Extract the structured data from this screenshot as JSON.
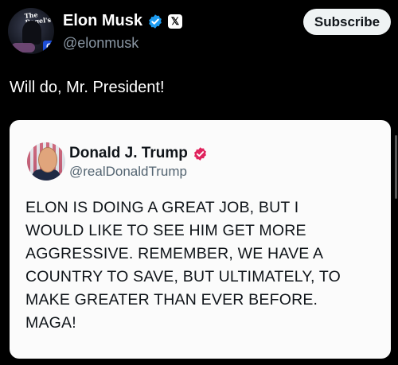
{
  "post": {
    "author": {
      "display_name": "Elon Musk",
      "handle": "@elonmusk",
      "avatar_text": "The Bagel's",
      "avatar_badge": "C",
      "verified_icon": "verified-badge-icon",
      "x_badge_text": "𝕏"
    },
    "subscribe_label": "Subscribe",
    "text": "Will do, Mr. President!"
  },
  "quote": {
    "author": {
      "display_name": "Donald J. Trump",
      "handle": "@realDonaldTrump",
      "verified_icon": "verified-badge-icon"
    },
    "lines": [
      "ELON IS DOING A GREAT JOB, BUT I",
      "WOULD LIKE TO SEE HIM GET MORE",
      "AGGRESSIVE. REMEMBER, WE HAVE A",
      "COUNTRY TO SAVE, BUT ULTIMATELY, TO",
      "MAKE GREATER THAN EVER BEFORE.",
      "MAGA!"
    ]
  },
  "colors": {
    "background": "#000000",
    "verified_blue": "#1d9bf0",
    "verified_pink": "#e0245e",
    "quote_background": "#fbfbfb",
    "muted_text": "#8b98a5"
  }
}
